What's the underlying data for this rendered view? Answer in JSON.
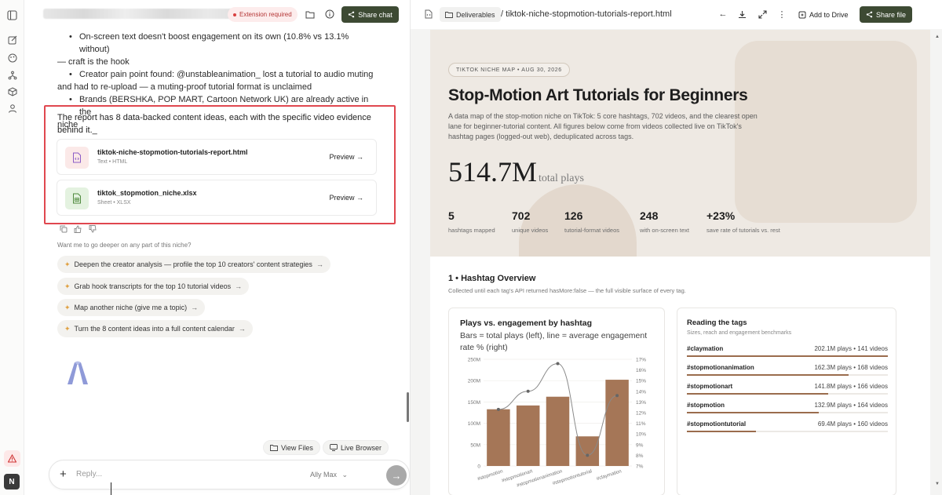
{
  "chat": {
    "extension_badge": "Extension required",
    "share_label": "Share chat",
    "bullets": [
      {
        "line1": "On-screen text doesn't boost engagement on its own (10.8% vs 13.1% without)",
        "line2": "— craft is the hook"
      },
      {
        "line1": "Creator pain point found: @unstableanimation_ lost a tutorial to audio muting",
        "line2": "and had to re-upload — a muting-proof tutorial format is unclaimed"
      },
      {
        "line1": "Brands (BERSHKA, POP MART, Cartoon Network UK) are already active in the",
        "line2": "niche"
      }
    ],
    "summary_line1": "The report has 8 data-backed content ideas, each with the specific video evidence",
    "summary_line2": "behind it._",
    "files": [
      {
        "name": "tiktok-niche-stopmotion-tutorials-report.html",
        "meta": "Text • HTML",
        "action": "Preview →",
        "icon": "code-file-icon"
      },
      {
        "name": "tiktok_stopmotion_niche.xlsx",
        "meta": "Sheet • XLSX",
        "action": "Preview →",
        "icon": "sheet-file-icon"
      }
    ],
    "followup_prompt": "Want me to go deeper on any part of this niche?",
    "suggestions": [
      "Deepen the creator analysis — profile the top 10 creators' content strategies",
      "Grab hook transcripts for the top 10 tutorial videos",
      "Map another niche (give me a topic)",
      "Turn the 8 content ideas into a full content calendar"
    ],
    "view_files": "View Files",
    "live_browser": "Live Browser",
    "composer_placeholder": "Reply...",
    "model_name": "Ally Max",
    "avatar_initial": "N"
  },
  "viewer": {
    "folder": "Deliverables",
    "filename": "/ tiktok-niche-stopmotion-tutorials-report.html",
    "add_drive": "Add to Drive",
    "share_file": "Share file"
  },
  "report": {
    "tag": "TIKTOK NICHE MAP  •  AUG 30, 2026",
    "title": "Stop-Motion Art Tutorials for Beginners",
    "lede_1": "A data map of the stop-motion niche on TikTok: 5 core hashtags, 702 videos, and the clearest open",
    "lede_2": "lane for beginner-tutorial content. All figures below come from videos collected live on TikTok's",
    "lede_3": "hashtag pages (logged-out web), deduplicated across tags.",
    "big_number": "514.7M",
    "big_unit": "total plays",
    "stats": [
      {
        "value": "5",
        "label": "hashtags mapped"
      },
      {
        "value": "702",
        "label": "unique videos"
      },
      {
        "value": "126",
        "label": "tutorial-format videos"
      },
      {
        "value": "248",
        "label": "with on-screen text"
      },
      {
        "value": "+23%",
        "label": "save rate of tutorials vs. rest"
      }
    ],
    "section_title": "1  •  Hashtag Overview",
    "section_sub": "Collected until each tag's API returned hasMore:false — the full visible surface of every tag.",
    "chart_title": "Plays vs. engagement by hashtag",
    "chart_sub_1": "Bars = total plays (left), line = average engagement",
    "chart_sub_2": "rate % (right)",
    "tags_title": "Reading the tags",
    "tags_sub": "Sizes, reach and engagement benchmarks",
    "tags": [
      {
        "name": "#claymation",
        "stats": "202.1M plays  •  141 videos",
        "fraction": 1.0
      },
      {
        "name": "#stopmotionanimation",
        "stats": "162.3M plays  •  168 videos",
        "fraction": 0.803
      },
      {
        "name": "#stopmotionart",
        "stats": "141.8M plays  •  166 videos",
        "fraction": 0.702
      },
      {
        "name": "#stopmotion",
        "stats": "132.9M plays  •  164 videos",
        "fraction": 0.658
      },
      {
        "name": "#stopmotiontutorial",
        "stats": "69.4M plays  •  160 videos",
        "fraction": 0.343
      }
    ]
  },
  "chart_data": {
    "type": "bar",
    "title": "Plays vs. engagement by hashtag",
    "categories": [
      "#stopmotion",
      "#stopmotionart",
      "#stopmotionanimation",
      "#stopmotiontutorial",
      "#claymation"
    ],
    "series": [
      {
        "name": "Bars = total plays (left)",
        "type": "bar",
        "axis": "left",
        "values": [
          132.9,
          141.8,
          162.3,
          69.4,
          202.1
        ]
      },
      {
        "name": "line = average engagement rate % (right)",
        "type": "line",
        "axis": "right",
        "values": [
          12.3,
          14.0,
          16.6,
          8.0,
          13.6
        ]
      }
    ],
    "y_left": {
      "ticks": [
        "0",
        "50M",
        "100M",
        "150M",
        "200M",
        "250M"
      ],
      "range": [
        0,
        250
      ]
    },
    "y_right": {
      "ticks": [
        "7%",
        "8%",
        "9%",
        "10%",
        "11%",
        "12%",
        "13%",
        "14%",
        "15%",
        "16%",
        "17%"
      ],
      "range": [
        7,
        17
      ]
    },
    "bar_color": "#a57657",
    "line_color": "#8a8a8a",
    "grid": true
  },
  "colors": {
    "accent_dark": "#3d4a33",
    "highlight_border": "#e0474f",
    "hero_bg": "#eee9e3",
    "bar_fill": "#9a6c4d"
  }
}
